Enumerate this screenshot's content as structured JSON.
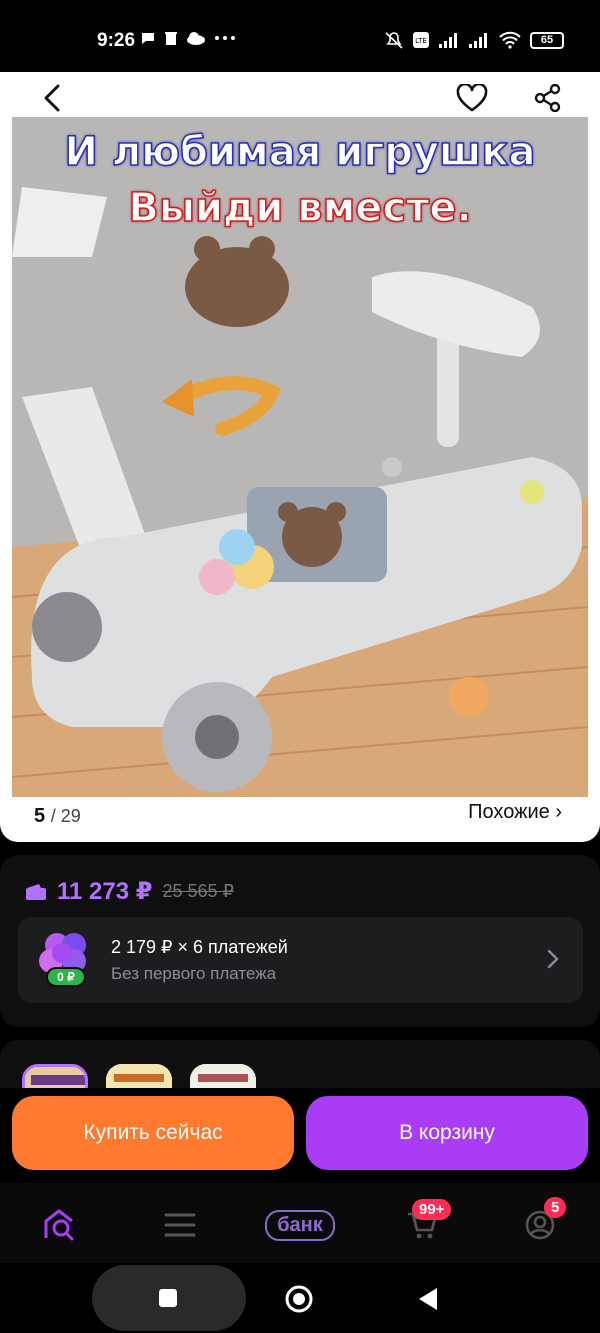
{
  "status_bar": {
    "time": "9:26",
    "left_icons": [
      "chat-bubble-icon",
      "trash-icon",
      "cloud-icon",
      "more-dots-icon"
    ],
    "right_icons": [
      "muted-alarm-icon",
      "volte-icon",
      "signal-icon",
      "signal-icon",
      "wifi-icon"
    ],
    "battery": "65"
  },
  "product": {
    "overlay_line1": "И любимая игрушка",
    "overlay_line2": "Выйди вместе.",
    "image_counter_current": "5",
    "image_counter_total": "/ 29",
    "similar_link": "Похожие ›"
  },
  "price": {
    "current": "11 273 ₽",
    "old": "25 565 ₽",
    "installments_main": "2 179 ₽ × 6 платежей",
    "installments_sub": "Без первого платежа",
    "installments_badge": "0 ₽"
  },
  "actions": {
    "buy_now": "Купить сейчас",
    "add_to_cart": "В корзину"
  },
  "tabbar": {
    "bank_label": "банк",
    "cart_badge": "99+",
    "profile_badge": "5"
  },
  "colors": {
    "accent_purple": "#a93cf4",
    "price_purple": "#b072ff",
    "buy_orange": "#ff7a2f",
    "badge_red": "#ff2b55"
  }
}
